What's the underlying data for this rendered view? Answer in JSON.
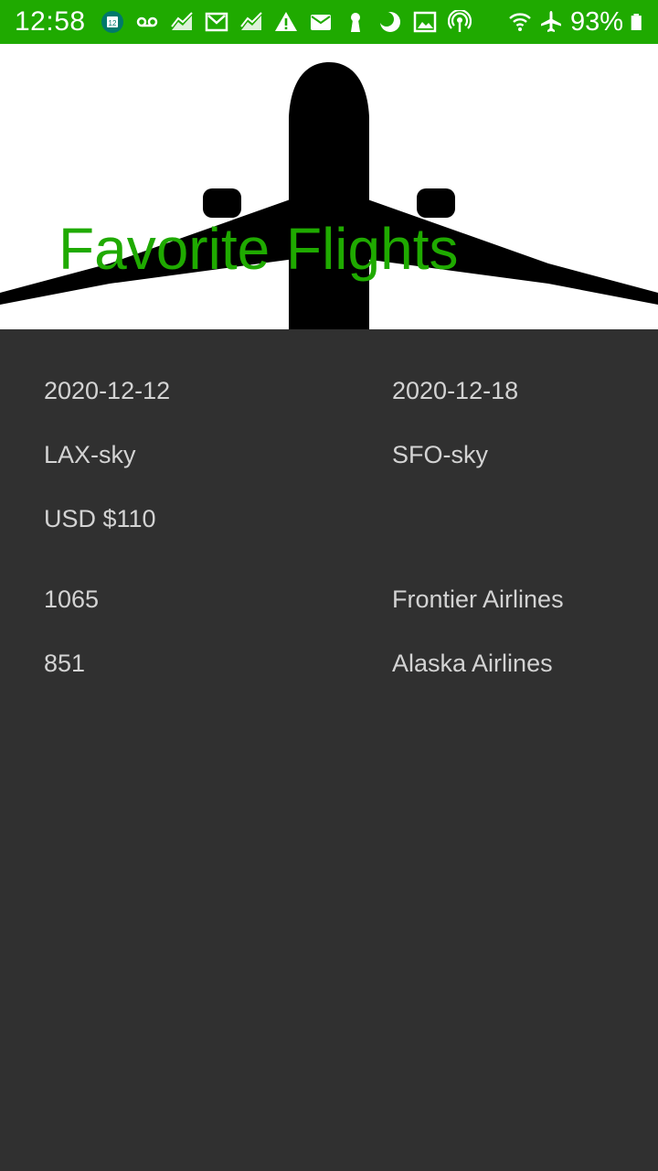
{
  "status_bar": {
    "time": "12:58",
    "calendar_day": "12",
    "battery_percent": "93%",
    "notification_icons": [
      "calendar-icon",
      "voicemail-icon",
      "chart-icon",
      "gmail-icon",
      "chart-icon",
      "warning-icon",
      "mail-icon",
      "keyhole-icon",
      "moon-icon",
      "image-icon",
      "podcast-icon"
    ],
    "system_icons": [
      "wifi-icon",
      "airplane-mode-icon",
      "battery-icon"
    ]
  },
  "header": {
    "title": "Favorite Flights",
    "title_color": "#1faa00",
    "background_icon": "airplane-silhouette"
  },
  "flights": {
    "depart_date": "2020-12-12",
    "return_date": "2020-12-18",
    "origin": "LAX-sky",
    "destination": "SFO-sky",
    "price": "USD $110",
    "legs": [
      {
        "flight_number": "1065",
        "airline": "Frontier Airlines"
      },
      {
        "flight_number": "851",
        "airline": "Alaska Airlines"
      }
    ]
  },
  "colors": {
    "status_bar": "#1faa00",
    "accent": "#1faa00",
    "background": "#303030",
    "text": "#d3d3d3"
  }
}
